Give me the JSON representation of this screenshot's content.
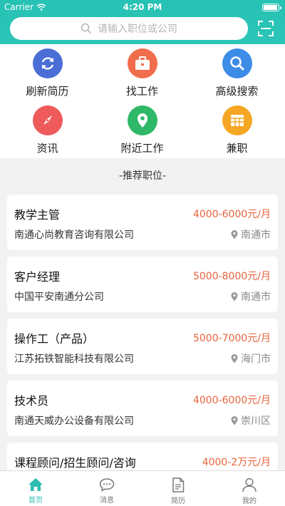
{
  "status_bar": {
    "carrier": "Carrier",
    "time": "4:20 PM"
  },
  "search": {
    "placeholder": "请输入职位或公司"
  },
  "quick_nav": [
    {
      "label": "刷新简历",
      "icon": "refresh-icon",
      "color": "#4a6ed6"
    },
    {
      "label": "找工作",
      "icon": "briefcase-icon",
      "color": "#f06d4d"
    },
    {
      "label": "高级搜索",
      "icon": "search-icon",
      "color": "#3d8ce8"
    },
    {
      "label": "资讯",
      "icon": "compass-icon",
      "color": "#ef5b5b"
    },
    {
      "label": "附近工作",
      "icon": "location-pin-icon",
      "color": "#2fb867"
    },
    {
      "label": "兼职",
      "icon": "grid-icon",
      "color": "#f5a623"
    }
  ],
  "section_title": "-推荐职位-",
  "jobs": [
    {
      "title": "教学主管",
      "salary": "4000-6000元/月",
      "company": "南通心尚教育咨询有限公司",
      "location": "南通市"
    },
    {
      "title": "客户经理",
      "salary": "5000-8000元/月",
      "company": "中国平安南通分公司",
      "location": "南通市"
    },
    {
      "title": "操作工（产品）",
      "salary": "5000-7000元/月",
      "company": "江苏拓铁智能科技有限公司",
      "location": "海门市"
    },
    {
      "title": "技术员",
      "salary": "4000-6000元/月",
      "company": "南通天威办公设备有限公司",
      "location": "崇川区"
    },
    {
      "title": "课程顾问/招生顾问/咨询",
      "salary": "4000-2万元/月",
      "company": "",
      "location": ""
    }
  ],
  "tabs": [
    {
      "label": "首页",
      "icon": "home-icon",
      "active": true
    },
    {
      "label": "消息",
      "icon": "message-icon",
      "active": false
    },
    {
      "label": "简历",
      "icon": "resume-icon",
      "active": false
    },
    {
      "label": "我的",
      "icon": "profile-icon",
      "active": false
    }
  ],
  "colors": {
    "brand": "#2cc5b7",
    "salary": "#e8643c",
    "tab_active": "#2cbcb0"
  }
}
